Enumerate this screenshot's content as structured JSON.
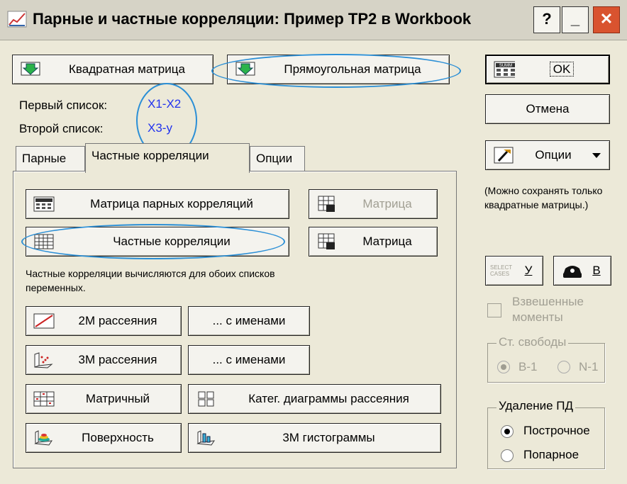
{
  "window": {
    "title": "Парные и частные корреляции: Пример ТР2 в Workbook",
    "help_btn": "?",
    "min_btn": "_",
    "close_btn": "✕"
  },
  "top": {
    "square_matrix": "Квадратная матрица",
    "rect_matrix": "Прямоугольная матрица",
    "first_list_label": "Первый список:",
    "first_list_value": "X1-X2",
    "second_list_label": "Второй список:",
    "second_list_value": "X3-y"
  },
  "tabs": [
    "Парные",
    "Частные корреляции",
    "Опции"
  ],
  "panel": {
    "pair_matrix": "Матрица парных корреляций",
    "matrix_disabled": "Матрица",
    "partial": "Частные корреляции",
    "matrix": "Матрица",
    "note": "Частные корреляции вычисляются для обоих списков переменных.",
    "scatter2d": "2М рассеяния",
    "names1": "... с именами",
    "scatter3d": "3М рассеяния",
    "names2": "... с именами",
    "matrix_plot": "Матричный",
    "categ": "Катег. диаграммы рассеяния",
    "surface": "Поверхность",
    "hist3d": "3М гистограммы"
  },
  "right": {
    "ok": "OK",
    "summ": "SUMM",
    "cancel": "Отмена",
    "options": "Опции",
    "note": "(Можно сохранять только квадратные матрицы.)",
    "select_cases": "SELECT CASES",
    "select_key": "У",
    "weights_key": "В",
    "weighted": "Взвешенные моменты",
    "df_title": "Ст. свободы",
    "df_b1": "В-1",
    "df_n1": "N-1",
    "md_title": "Удаление ПД",
    "md_row": "Построчное",
    "md_pair": "Попарное"
  },
  "colors": {
    "accent_blue": "#2233ee",
    "highlight": "#2b8fd6",
    "close_red": "#d9532f"
  }
}
